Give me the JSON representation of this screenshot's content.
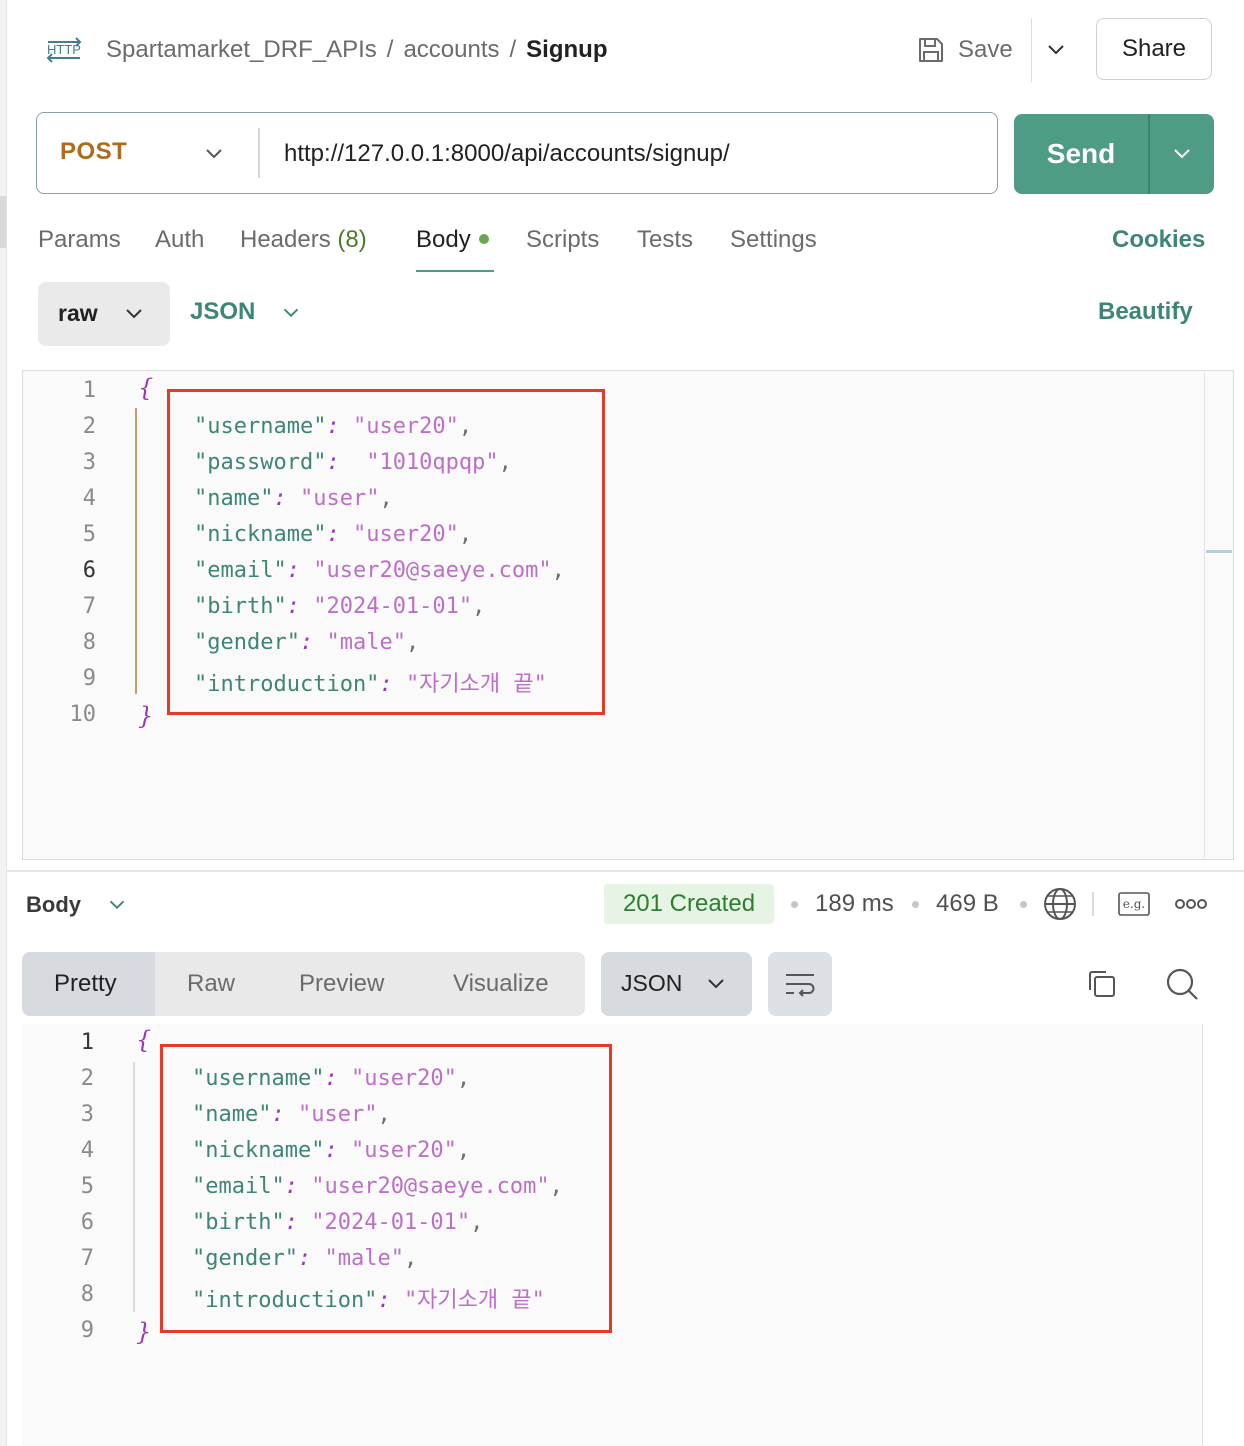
{
  "breadcrumb": {
    "collection": "Spartamarket_DRF_APIs",
    "folder": "accounts",
    "request": "Signup",
    "separator": "/"
  },
  "header": {
    "save_label": "Save",
    "share_label": "Share",
    "http_icon_text": "HTTP"
  },
  "request": {
    "method": "POST",
    "url": "http://127.0.0.1:8000/api/accounts/signup/",
    "send_label": "Send"
  },
  "request_tabs": {
    "params": "Params",
    "auth": "Auth",
    "headers": "Headers",
    "headers_count": "(8)",
    "body": "Body",
    "scripts": "Scripts",
    "tests": "Tests",
    "settings": "Settings",
    "cookies": "Cookies",
    "active": "Body"
  },
  "body_mode": {
    "mode": "raw",
    "language": "JSON",
    "beautify": "Beautify"
  },
  "request_body": {
    "open_brace": "{",
    "close_brace": "}",
    "current_line": 6,
    "line_numbers": [
      "1",
      "2",
      "3",
      "4",
      "5",
      "6",
      "7",
      "8",
      "9",
      "10"
    ],
    "lines": [
      {
        "key": "\"username\"",
        "sep": ": ",
        "value": "\"user20\"",
        "end": ","
      },
      {
        "key": "\"password\"",
        "sep": ":  ",
        "value": "\"1010qpqp\"",
        "end": ","
      },
      {
        "key": "\"name\"",
        "sep": ": ",
        "value": "\"user\"",
        "end": ","
      },
      {
        "key": "\"nickname\"",
        "sep": ": ",
        "value": "\"user20\"",
        "end": ","
      },
      {
        "key": "\"email\"",
        "sep": ": ",
        "value": "\"user20@saeye.com\"",
        "end": ","
      },
      {
        "key": "\"birth\"",
        "sep": ": ",
        "value": "\"2024-01-01\"",
        "end": ","
      },
      {
        "key": "\"gender\"",
        "sep": ": ",
        "value": "\"male\"",
        "end": ","
      },
      {
        "key": "\"introduction\"",
        "sep": ": ",
        "value": "\"자기소개 끝\"",
        "end": ""
      }
    ]
  },
  "response": {
    "section_label": "Body",
    "status": "201 Created",
    "time": "189 ms",
    "size": "469 B",
    "view_tabs": [
      "Pretty",
      "Raw",
      "Preview",
      "Visualize"
    ],
    "active_view": "Pretty",
    "language": "JSON",
    "eg_label": "e.g.",
    "status_colors": {
      "text": "#2e7d32",
      "background": "#e5f4e3"
    }
  },
  "response_body": {
    "open_brace": "{",
    "close_brace": "}",
    "line_numbers": [
      "1",
      "2",
      "3",
      "4",
      "5",
      "6",
      "7",
      "8",
      "9"
    ],
    "lines": [
      {
        "key": "\"username\"",
        "sep": ": ",
        "value": "\"user20\"",
        "end": ","
      },
      {
        "key": "\"name\"",
        "sep": ": ",
        "value": "\"user\"",
        "end": ","
      },
      {
        "key": "\"nickname\"",
        "sep": ": ",
        "value": "\"user20\"",
        "end": ","
      },
      {
        "key": "\"email\"",
        "sep": ": ",
        "value": "\"user20@saeye.com\"",
        "end": ","
      },
      {
        "key": "\"birth\"",
        "sep": ": ",
        "value": "\"2024-01-01\"",
        "end": ","
      },
      {
        "key": "\"gender\"",
        "sep": ": ",
        "value": "\"male\"",
        "end": ","
      },
      {
        "key": "\"introduction\"",
        "sep": ": ",
        "value": "\"자기소개 끝\"",
        "end": ""
      }
    ]
  },
  "colors": {
    "accent": "#4f9c86",
    "method_post": "#ae6a1d",
    "json_key": "#3f8575",
    "json_value": "#bd6fc7",
    "highlight_box": "#e53a24"
  },
  "icons": {
    "request_type": "http-icon",
    "save": "floppy-disk-icon",
    "dropdown": "chevron-down-icon",
    "network": "globe-icon",
    "examples": "eg-icon",
    "more": "more-options-icon",
    "wrap": "wrap-lines-icon",
    "copy": "copy-icon",
    "search": "search-icon"
  }
}
